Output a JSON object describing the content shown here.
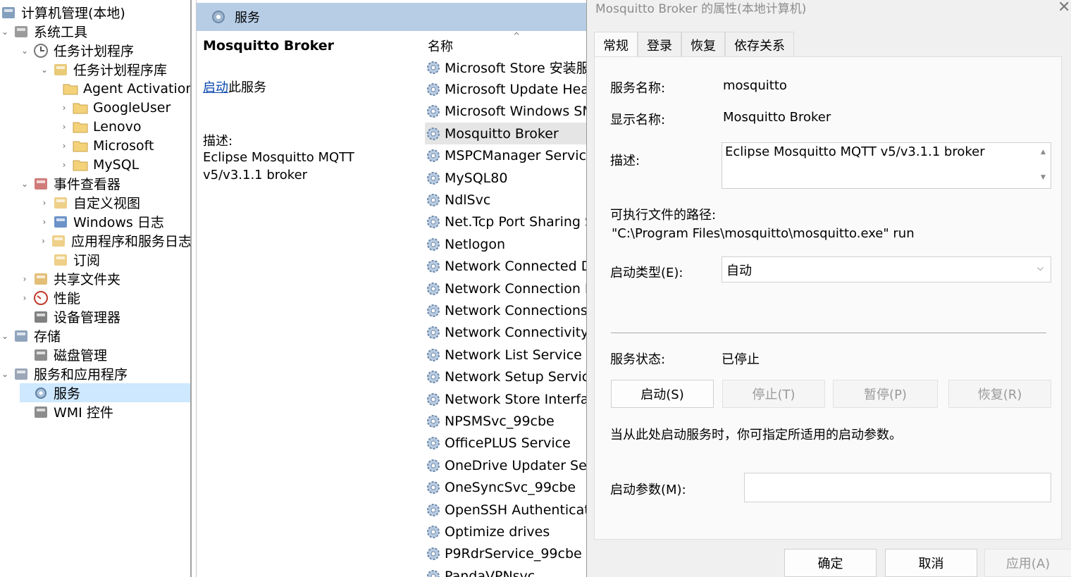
{
  "tree": {
    "items": [
      {
        "label": "计算机管理(本地)",
        "icon": "computer-management-icon"
      },
      {
        "label": "系统工具",
        "icon": "system-tools-icon"
      },
      {
        "label": "任务计划程序",
        "icon": "clock-icon"
      },
      {
        "label": "任务计划程序库",
        "icon": "task-library-icon"
      },
      {
        "label": "Agent Activation",
        "icon": "folder-icon"
      },
      {
        "label": "GoogleUser",
        "icon": "folder-icon"
      },
      {
        "label": "Lenovo",
        "icon": "folder-icon"
      },
      {
        "label": "Microsoft",
        "icon": "folder-icon"
      },
      {
        "label": "MySQL",
        "icon": "folder-icon"
      },
      {
        "label": "事件查看器",
        "icon": "event-viewer-icon"
      },
      {
        "label": "自定义视图",
        "icon": "custom-views-icon"
      },
      {
        "label": "Windows 日志",
        "icon": "windows-logs-icon"
      },
      {
        "label": "应用程序和服务日志",
        "icon": "app-logs-icon"
      },
      {
        "label": "订阅",
        "icon": "subscriptions-icon"
      },
      {
        "label": "共享文件夹",
        "icon": "shared-folders-icon"
      },
      {
        "label": "性能",
        "icon": "performance-icon"
      },
      {
        "label": "设备管理器",
        "icon": "device-manager-icon"
      },
      {
        "label": "存储",
        "icon": "storage-icon"
      },
      {
        "label": "磁盘管理",
        "icon": "disk-management-icon"
      },
      {
        "label": "服务和应用程序",
        "icon": "services-apps-icon"
      },
      {
        "label": "服务",
        "icon": "services-icon"
      },
      {
        "label": "WMI 控件",
        "icon": "wmi-icon"
      }
    ]
  },
  "services_pane": {
    "header_title": "服务",
    "selected_service_name": "Mosquitto Broker",
    "start_link": "启动",
    "start_link_suffix": "此服务",
    "description_label": "描述:",
    "description_text": "Eclipse Mosquitto MQTT v5/v3.1.1 broker",
    "column_name": "名称",
    "sort_indicator": "^",
    "services": [
      "Microsoft Store 安装服务",
      "Microsoft Update Health",
      "Microsoft Windows SMS",
      "Mosquitto Broker",
      "MSPCManager Service (",
      "MySQL80",
      "NdlSvc",
      "Net.Tcp Port Sharing Ser",
      "Netlogon",
      "Network Connected Dev",
      "Network Connection Bro",
      "Network Connections",
      "Network Connectivity As",
      "Network List Service",
      "Network Setup Service",
      "Network Store Interface",
      "NPSMSvc_99cbe",
      "OfficePLUS Service",
      "OneDrive Updater Servic",
      "OneSyncSvc_99cbe",
      "OpenSSH Authentication",
      "Optimize drives",
      "P9RdrService_99cbe",
      "PandaVPNsvc"
    ]
  },
  "dialog": {
    "title": "Mosquitto Broker 的属性(本地计算机)",
    "close": "✕",
    "tabs": [
      "常规",
      "登录",
      "恢复",
      "依存关系"
    ],
    "service_name_label": "服务名称:",
    "service_name_value": "mosquitto",
    "display_name_label": "显示名称:",
    "display_name_value": "Mosquitto Broker",
    "description_label": "描述:",
    "description_value": "Eclipse Mosquitto MQTT v5/v3.1.1 broker",
    "path_label": "可执行文件的路径:",
    "path_value": "\"C:\\Program Files\\mosquitto\\mosquitto.exe\" run",
    "startup_type_label": "启动类型(E):",
    "startup_type_value": "自动",
    "status_label": "服务状态:",
    "status_value": "已停止",
    "start_button": "启动(S)",
    "stop_button": "停止(T)",
    "pause_button": "暂停(P)",
    "resume_button": "恢复(R)",
    "hint_text": "当从此处启动服务时，你可指定所适用的启动参数。",
    "params_label": "启动参数(M):",
    "params_value": "",
    "ok_button": "确定",
    "cancel_button": "取消",
    "apply_button": "应用(A)"
  },
  "colors": {
    "header_bg": "#b7cde6",
    "selection": "#cde8ff",
    "link": "#0645ad",
    "dialog_bg": "#f0f0f0"
  }
}
